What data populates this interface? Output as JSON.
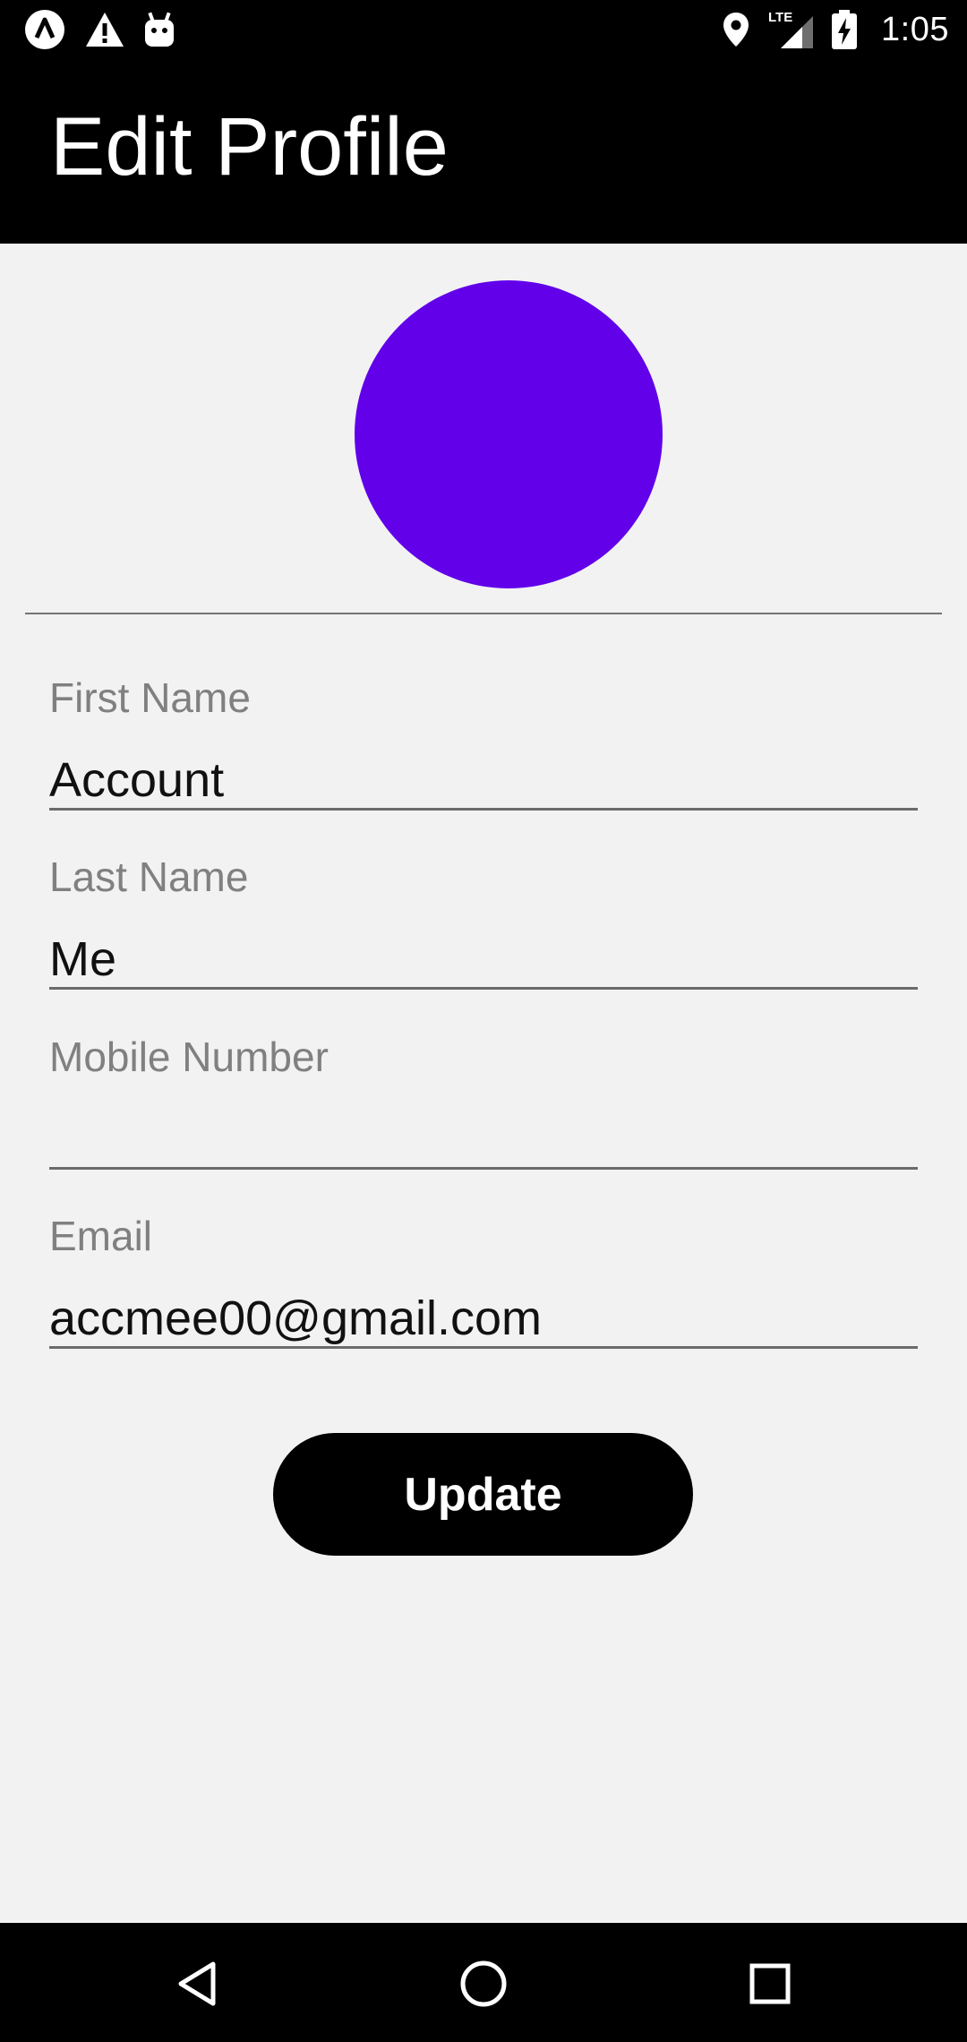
{
  "status_bar": {
    "time": "1:05",
    "network_type": "LTE",
    "left_icons": [
      "app-logo-icon",
      "warning-icon",
      "android-debug-icon"
    ],
    "right_icons": [
      "location-icon",
      "signal-icon",
      "battery-charging-icon"
    ]
  },
  "app_bar": {
    "title": "Edit Profile"
  },
  "avatar": {
    "color": "#6200ea"
  },
  "form": {
    "first_name": {
      "label": "First Name",
      "value": "Account"
    },
    "last_name": {
      "label": "Last Name",
      "value": "Me"
    },
    "mobile_number": {
      "label": "Mobile Number",
      "value": ""
    },
    "email": {
      "label": "Email",
      "value": "accmee00@gmail.com"
    }
  },
  "update_button": {
    "label": "Update"
  },
  "nav_bar": {
    "buttons": [
      "back-icon",
      "home-icon",
      "recents-icon"
    ]
  }
}
